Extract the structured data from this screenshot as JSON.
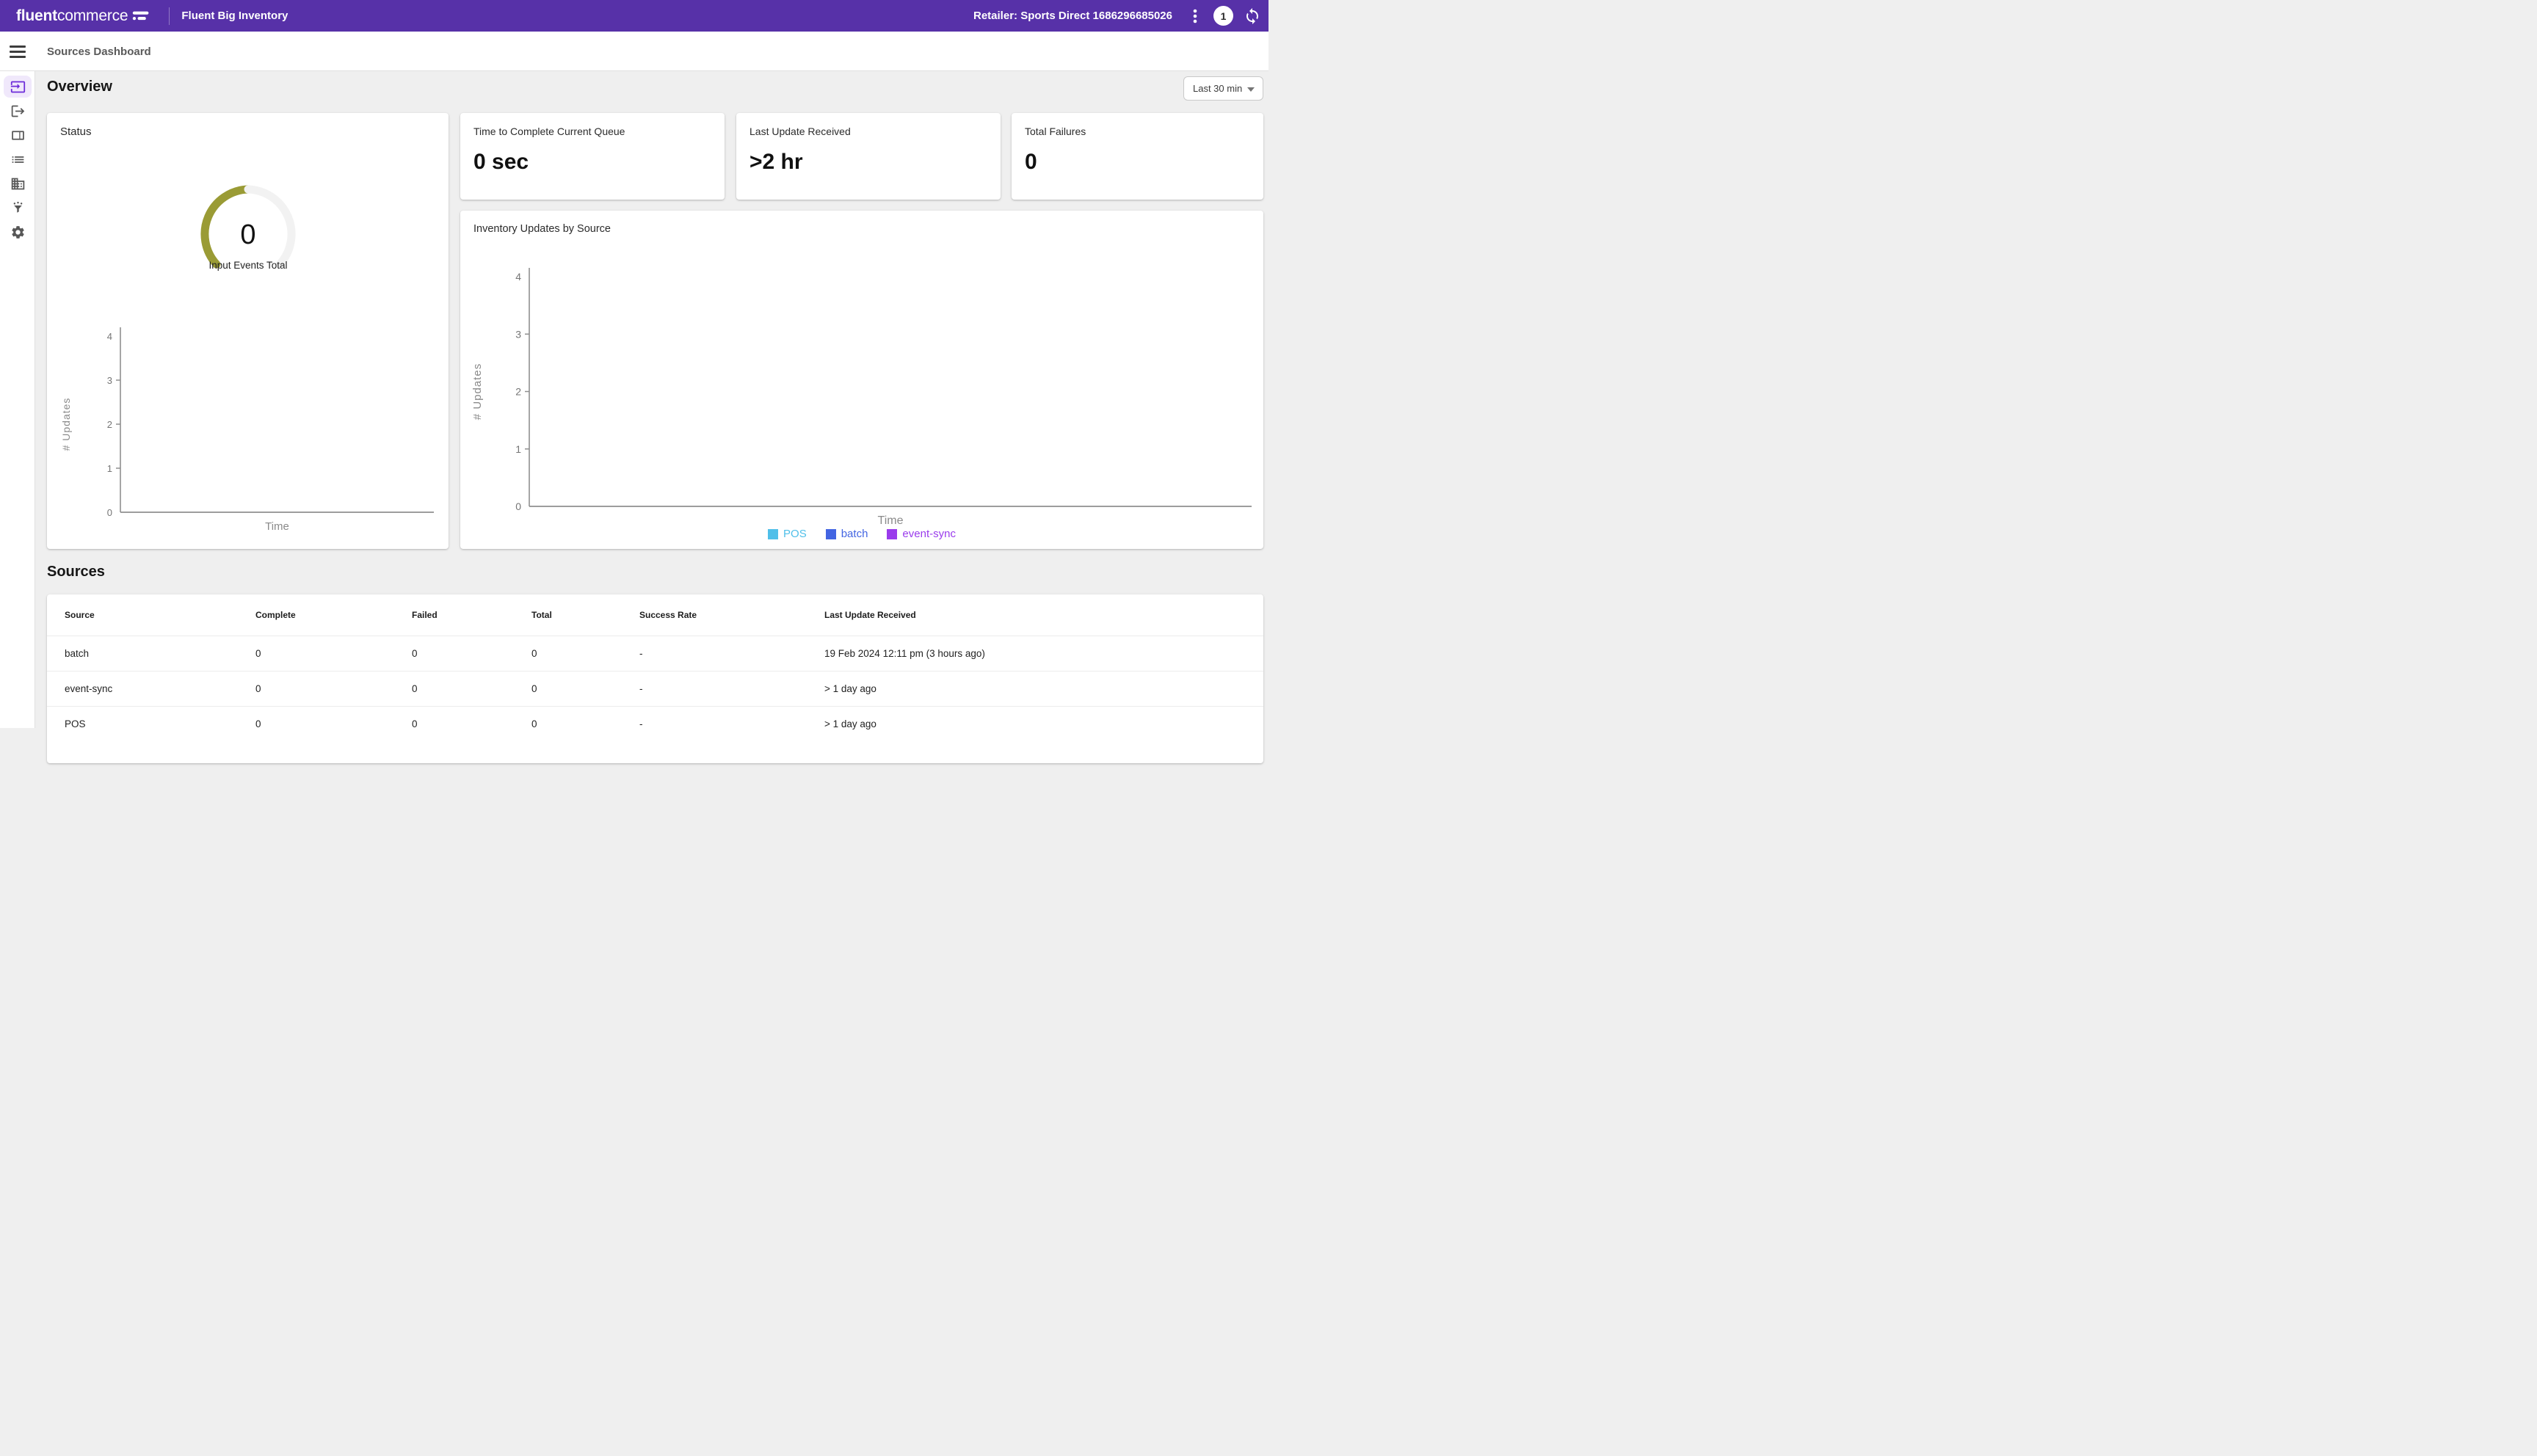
{
  "topbar": {
    "brand_bold": "fluent",
    "brand_light": "commerce",
    "app_title": "Fluent Big Inventory",
    "retailer_label": "Retailer: Sports Direct 1686296685026",
    "notification_count": "1"
  },
  "page": {
    "title": "Sources Dashboard"
  },
  "overview": {
    "heading": "Overview",
    "time_filter": {
      "selected": "Last 30 min"
    },
    "status_card": {
      "title": "Status",
      "gauge": {
        "value": "0",
        "label": "Input Events Total"
      }
    },
    "metric_cards": [
      {
        "title": "Time to Complete Current Queue",
        "value": "0 sec"
      },
      {
        "title": "Last Update Received",
        "value": ">2 hr"
      },
      {
        "title": "Total Failures",
        "value": "0"
      }
    ],
    "chart_card": {
      "title": "Inventory Updates by Source"
    }
  },
  "chart_data": [
    {
      "id": "status-updates-mini-chart",
      "type": "line",
      "title": "Status",
      "xlabel": "Time",
      "ylabel": "# Updates",
      "yticks": [
        0,
        1,
        2,
        3,
        4
      ],
      "ylim": [
        0,
        4
      ],
      "grid": false,
      "series": [],
      "note": "empty chart - no data points plotted"
    },
    {
      "id": "inventory-updates-by-source",
      "type": "line",
      "title": "Inventory Updates by Source",
      "xlabel": "Time",
      "ylabel": "# Updates",
      "yticks": [
        0,
        1,
        2,
        3,
        4
      ],
      "ylim": [
        0,
        4
      ],
      "grid": false,
      "legend_position": "bottom",
      "series": [
        {
          "name": "POS",
          "color": "#4FBFE9",
          "values": []
        },
        {
          "name": "batch",
          "color": "#4365E2",
          "values": []
        },
        {
          "name": "event-sync",
          "color": "#9A3BEC",
          "values": []
        }
      ],
      "note": "empty chart - no data points plotted"
    }
  ],
  "sources": {
    "heading": "Sources",
    "table": {
      "columns": [
        "Source",
        "Complete",
        "Failed",
        "Total",
        "Success Rate",
        "Last Update Received"
      ],
      "rows": [
        [
          "batch",
          "0",
          "0",
          "0",
          "-",
          "19 Feb 2024 12:11 pm (3 hours ago)"
        ],
        [
          "event-sync",
          "0",
          "0",
          "0",
          "-",
          "> 1 day ago"
        ],
        [
          "POS",
          "0",
          "0",
          "0",
          "-",
          "> 1 day ago"
        ]
      ]
    }
  },
  "colors": {
    "topbar": "#5731A8",
    "active_icon": "#6C2BD9",
    "active_icon_bg": "#F0E8FB",
    "sidebar_icon": "#575757",
    "gauge_filled": "#9A9B35",
    "gauge_empty": "#F2F2F2",
    "axis": "#8F8F8F",
    "tick_text": "#757575",
    "axis_label": "#8A8A8A"
  }
}
